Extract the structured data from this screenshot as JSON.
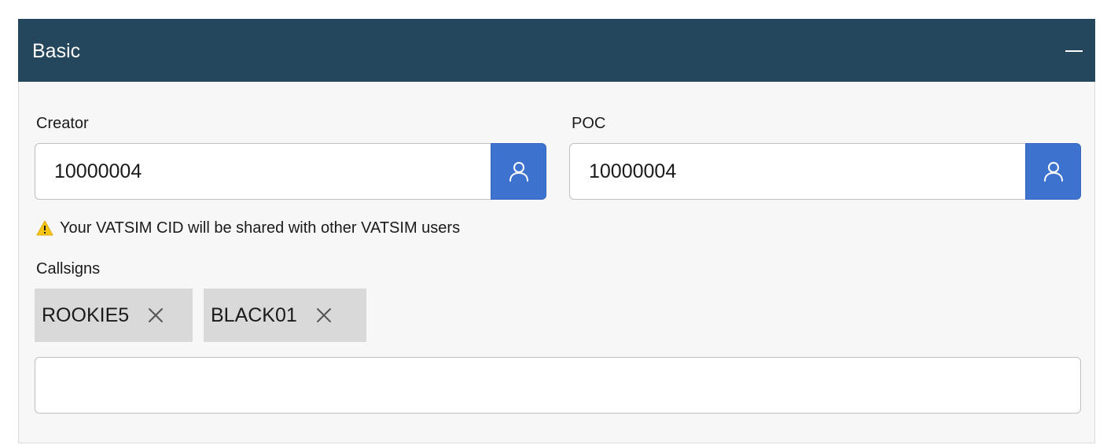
{
  "panel": {
    "title": "Basic"
  },
  "creator": {
    "label": "Creator",
    "value": "10000004"
  },
  "poc": {
    "label": "POC",
    "value": "10000004"
  },
  "warning": {
    "text": "Your VATSIM CID will be shared with other VATSIM users"
  },
  "callsigns": {
    "label": "Callsigns",
    "chips": [
      "ROOKIE5",
      "BLACK01"
    ],
    "input_value": ""
  },
  "colors": {
    "header": "#25475e",
    "button": "#3d73cf",
    "chip": "#d9d9d9",
    "warning": "#f5c518"
  }
}
